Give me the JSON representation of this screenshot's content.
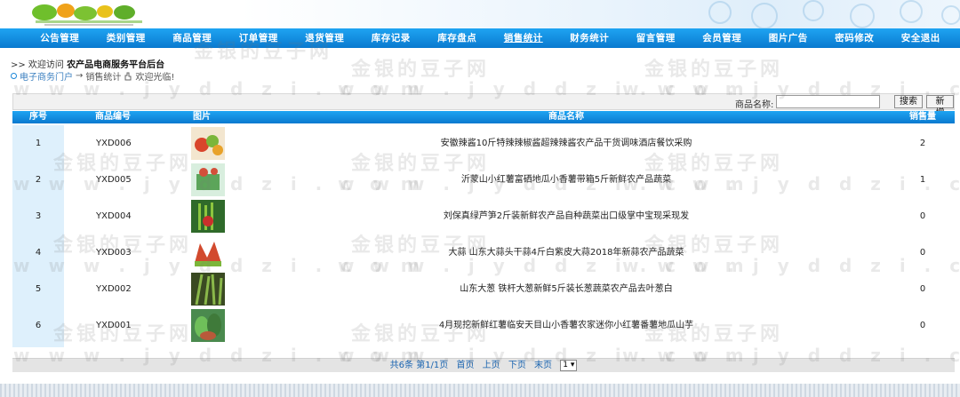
{
  "nav": [
    "公告管理",
    "类别管理",
    "商品管理",
    "订单管理",
    "退货管理",
    "库存记录",
    "库存盘点",
    "销售统计",
    "财务统计",
    "留言管理",
    "会员管理",
    "图片广告",
    "密码修改",
    "安全退出"
  ],
  "nav_active_index": 7,
  "welcome": {
    "prefix": ">> 欢迎访问",
    "title": "农产品电商服务平台后台"
  },
  "breadcrumb": {
    "root": "电子商务门户",
    "arrow": "→",
    "page": "销售统计",
    "greet": "欢迎光临!"
  },
  "search": {
    "label": "商品名称:",
    "value": "",
    "search_label": "搜索",
    "add_label": "新增"
  },
  "table": {
    "headers": {
      "idx": "序号",
      "code": "商品编号",
      "img": "图片",
      "name": "商品名称",
      "sold": "销售量"
    },
    "rows": [
      {
        "idx": "1",
        "code": "YXD006",
        "name": "安徽辣酱10斤特辣辣椒酱超辣辣酱农产品干货调味酒店餐饮采购",
        "sold": "2",
        "thumb_color": "#b9733a"
      },
      {
        "idx": "2",
        "code": "YXD005",
        "name": "沂蒙山小红薯富硒地瓜小香薯带箱5斤新鲜农产品蔬菜",
        "sold": "1",
        "thumb_color": "#5ca55a"
      },
      {
        "idx": "3",
        "code": "YXD004",
        "name": "刘保真绿芦笋2斤装新鲜农产品自种蔬菜出口级掌中宝现采现发",
        "sold": "0",
        "thumb_color": "#3b7e35"
      },
      {
        "idx": "4",
        "code": "YXD003",
        "name": "大蒜 山东大蒜头干蒜4斤白紫皮大蒜2018年新蒜农产品蔬菜",
        "sold": "0",
        "thumb_color": "#d24a2e"
      },
      {
        "idx": "5",
        "code": "YXD002",
        "name": "山东大葱 铁杆大葱新鲜5斤装长葱蔬菜农产品去叶葱白",
        "sold": "0",
        "thumb_color": "#4d6a30"
      },
      {
        "idx": "6",
        "code": "YXD001",
        "name": "4月现挖新鲜红薯临安天目山小香薯农家迷你小红薯番薯地瓜山芋",
        "sold": "0",
        "thumb_color": "#3f8a49"
      }
    ]
  },
  "pager": {
    "summary": "共6条 第1/1页",
    "first": "首页",
    "prev": "上页",
    "next": "下页",
    "last": "末页",
    "page_value": "1 ▾"
  },
  "watermark": {
    "cn": "金银的豆子网",
    "en": "w w w . j y d d z i . c o m"
  }
}
